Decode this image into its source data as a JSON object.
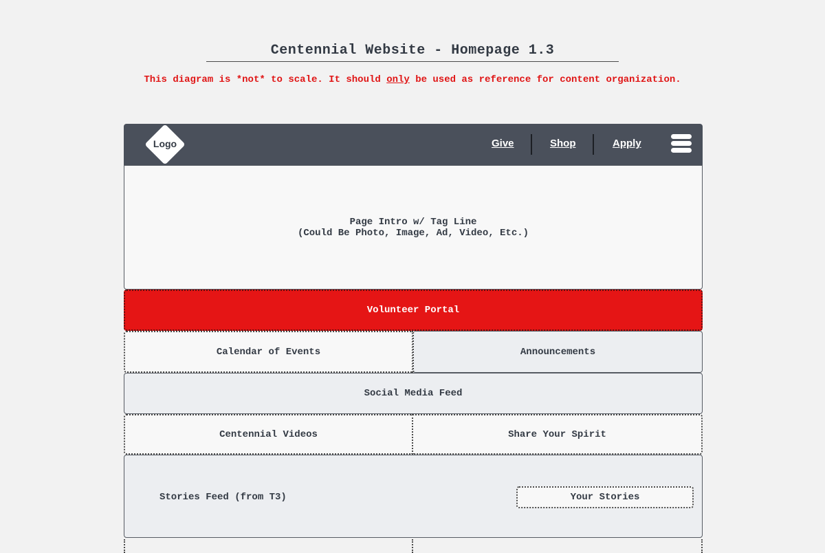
{
  "header": {
    "title": "Centennial Website - Homepage 1.3",
    "note_before": "This diagram is *not* to scale. It should ",
    "note_emphasis": "only",
    "note_after": " be used as reference for content organization."
  },
  "navbar": {
    "logo": "Logo",
    "links": [
      "Give",
      "Shop",
      "Apply"
    ],
    "menu_icon": "hamburger-menu-icon"
  },
  "sections": {
    "intro_line1": "Page Intro w/ Tag Line",
    "intro_line2": "(Could Be Photo, Image, Ad, Video, Etc.)",
    "volunteer": "Volunteer Portal",
    "calendar": "Calendar of Events",
    "announcements": "Announcements",
    "social": "Social Media Feed",
    "videos": "Centennial Videos",
    "spirit": "Share Your Spirit",
    "stories_feed": "Stories Feed (from T3)",
    "your_stories": "Your Stories"
  },
  "colors": {
    "navbar": "#4a505b",
    "accent_red": "#e51515",
    "note_red": "#e01515",
    "grey_block": "#eceef1",
    "background": "#f2f2f2"
  }
}
